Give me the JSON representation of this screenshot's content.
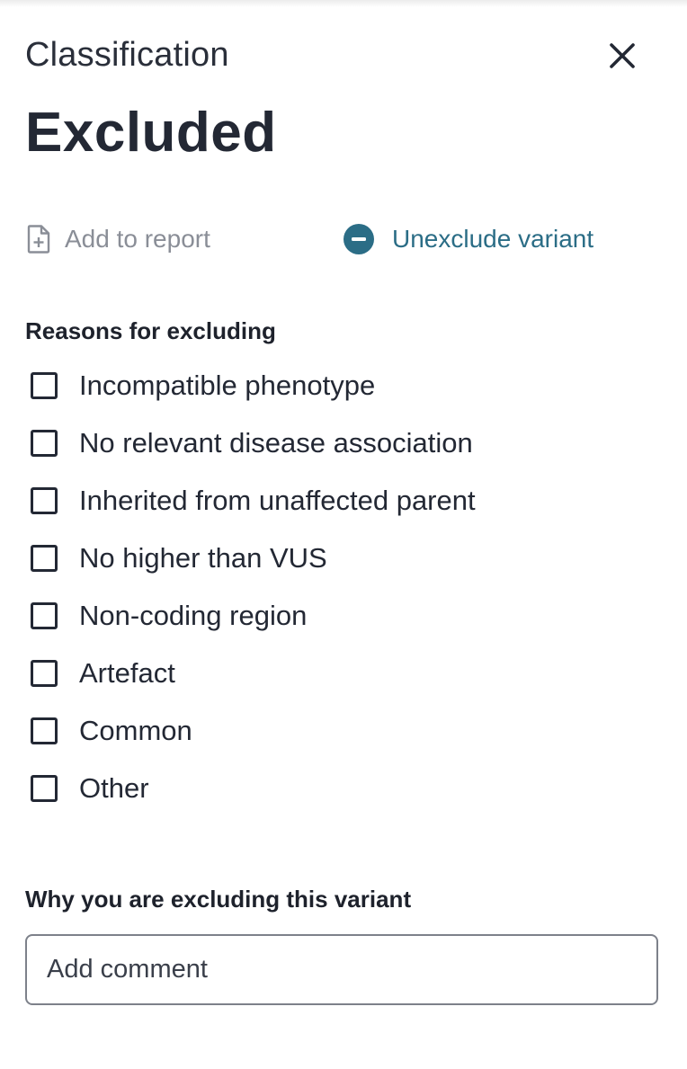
{
  "header": {
    "kicker": "Classification",
    "title": "Excluded",
    "close_icon": "close-icon"
  },
  "actions": {
    "add_to_report": {
      "label": "Add to report",
      "icon": "file-plus-icon",
      "color": "#8a8e97"
    },
    "unexclude": {
      "label": "Unexclude variant",
      "icon": "minus-circle-icon",
      "color": "#2b6d86"
    }
  },
  "reasons": {
    "title": "Reasons for excluding",
    "items": [
      {
        "label": "Incompatible phenotype",
        "checked": false
      },
      {
        "label": "No relevant disease association",
        "checked": false
      },
      {
        "label": "Inherited from unaffected parent",
        "checked": false
      },
      {
        "label": "No higher than VUS",
        "checked": false
      },
      {
        "label": "Non-coding region",
        "checked": false
      },
      {
        "label": "Artefact",
        "checked": false
      },
      {
        "label": "Common",
        "checked": false
      },
      {
        "label": "Other",
        "checked": false
      }
    ]
  },
  "comment": {
    "title": "Why you are excluding this variant",
    "placeholder": "Add comment",
    "value": ""
  }
}
